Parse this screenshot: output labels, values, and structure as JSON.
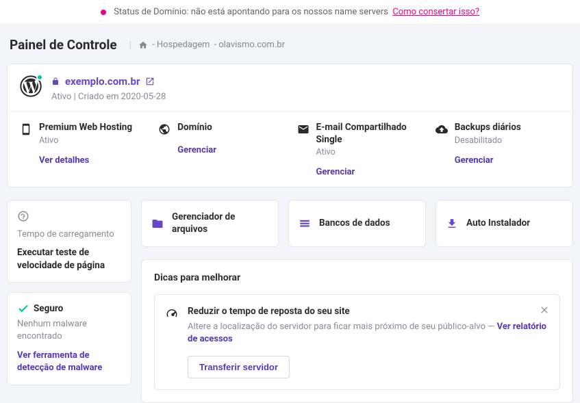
{
  "status_bar": {
    "text": "Status de Domínio: não está apontando para os nossos name servers",
    "link": "Como consertar isso?"
  },
  "page_title": "Painel de Controle",
  "breadcrumb": {
    "item1": "- Hospedagem",
    "item2": "- olavismo.com.br"
  },
  "site": {
    "domain": "exemplo.com.br",
    "meta": "Ativo | Criado em 2020-05-28"
  },
  "services": [
    {
      "title": "Premium Web Hosting",
      "status": "Ativo",
      "action": "Ver detalhes"
    },
    {
      "title": "Domínio",
      "status": "",
      "action": "Gerenciar"
    },
    {
      "title": "E-mail Compartilhado Single",
      "status": "Ativo",
      "action": "Gerenciar"
    },
    {
      "title": "Backups diários",
      "status": "Desabilitado",
      "action": "Gerenciar"
    }
  ],
  "left": {
    "load_label": "Tempo de carregamento",
    "load_action": "Executar teste de velocidade de página",
    "secure_title": "Seguro",
    "secure_sub": "Nenhum malware encontrado",
    "secure_action": "Ver ferramenta de detecção de malware"
  },
  "actions": [
    {
      "label": "Gerenciador de arquivos"
    },
    {
      "label": "Bancos de dados"
    },
    {
      "label": "Auto Instalador"
    }
  ],
  "tips": {
    "heading": "Dicas para melhorar",
    "tip_title": "Reduzir o tempo de reposta do seu site",
    "tip_desc": "Altere a localização do servidor para ficar mais próximo de seu público-alvo — ",
    "tip_link": "Ver relatório de acessos",
    "tip_button": "Transferir servidor"
  }
}
